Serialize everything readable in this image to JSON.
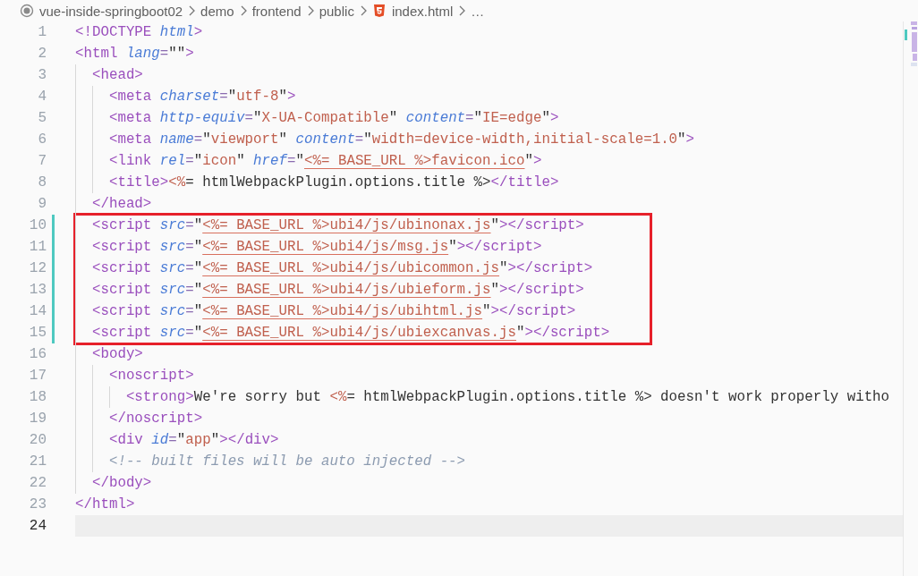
{
  "breadcrumb": {
    "items": [
      {
        "label": "vue-inside-springboot02",
        "kind": "root"
      },
      {
        "label": "demo",
        "kind": "folder"
      },
      {
        "label": "frontend",
        "kind": "folder"
      },
      {
        "label": "public",
        "kind": "folder"
      },
      {
        "label": "index.html",
        "kind": "html-file"
      }
    ],
    "more": "…"
  },
  "editor": {
    "lines": [
      {
        "number": "1",
        "modified": false,
        "boxed": false,
        "current": false,
        "tokens": [
          {
            "kind": "tag",
            "text": "<!DOCTYPE "
          },
          {
            "kind": "attr",
            "text": "html"
          },
          {
            "kind": "tag",
            "text": ">"
          }
        ]
      },
      {
        "number": "2",
        "modified": false,
        "boxed": false,
        "current": false,
        "tokens": [
          {
            "kind": "tag",
            "text": "<html "
          },
          {
            "kind": "attr",
            "text": "lang"
          },
          {
            "kind": "punct",
            "text": "="
          },
          {
            "kind": "text",
            "text": "\"\""
          },
          {
            "kind": "tag",
            "text": ">"
          }
        ]
      },
      {
        "number": "3",
        "modified": false,
        "boxed": false,
        "current": false,
        "tokens": [
          {
            "kind": "tag",
            "text": "  <head>"
          }
        ]
      },
      {
        "number": "4",
        "modified": false,
        "boxed": false,
        "current": false,
        "tokens": [
          {
            "kind": "tag",
            "text": "    <meta "
          },
          {
            "kind": "attr",
            "text": "charset"
          },
          {
            "kind": "punct",
            "text": "="
          },
          {
            "kind": "text",
            "text": "\""
          },
          {
            "kind": "string",
            "text": "utf-8"
          },
          {
            "kind": "text",
            "text": "\""
          },
          {
            "kind": "tag",
            "text": ">"
          }
        ]
      },
      {
        "number": "5",
        "modified": false,
        "boxed": false,
        "current": false,
        "tokens": [
          {
            "kind": "tag",
            "text": "    <meta "
          },
          {
            "kind": "attr",
            "text": "http-equiv"
          },
          {
            "kind": "punct",
            "text": "="
          },
          {
            "kind": "text",
            "text": "\""
          },
          {
            "kind": "string",
            "text": "X-UA-Compatible"
          },
          {
            "kind": "text",
            "text": "\" "
          },
          {
            "kind": "attr",
            "text": "content"
          },
          {
            "kind": "punct",
            "text": "="
          },
          {
            "kind": "text",
            "text": "\""
          },
          {
            "kind": "string",
            "text": "IE=edge"
          },
          {
            "kind": "text",
            "text": "\""
          },
          {
            "kind": "tag",
            "text": ">"
          }
        ]
      },
      {
        "number": "6",
        "modified": false,
        "boxed": false,
        "current": false,
        "tokens": [
          {
            "kind": "tag",
            "text": "    <meta "
          },
          {
            "kind": "attr",
            "text": "name"
          },
          {
            "kind": "punct",
            "text": "="
          },
          {
            "kind": "text",
            "text": "\""
          },
          {
            "kind": "string",
            "text": "viewport"
          },
          {
            "kind": "text",
            "text": "\" "
          },
          {
            "kind": "attr",
            "text": "content"
          },
          {
            "kind": "punct",
            "text": "="
          },
          {
            "kind": "text",
            "text": "\""
          },
          {
            "kind": "string",
            "text": "width=device-width,initial-scale=1.0"
          },
          {
            "kind": "text",
            "text": "\""
          },
          {
            "kind": "tag",
            "text": ">"
          }
        ]
      },
      {
        "number": "7",
        "modified": false,
        "boxed": false,
        "current": false,
        "tokens": [
          {
            "kind": "tag",
            "text": "    <link "
          },
          {
            "kind": "attr",
            "text": "rel"
          },
          {
            "kind": "punct",
            "text": "="
          },
          {
            "kind": "text",
            "text": "\""
          },
          {
            "kind": "string",
            "text": "icon"
          },
          {
            "kind": "text",
            "text": "\" "
          },
          {
            "kind": "attr",
            "text": "href"
          },
          {
            "kind": "punct",
            "text": "="
          },
          {
            "kind": "text",
            "text": "\""
          },
          {
            "kind": "url",
            "text": "<%= BASE_URL %>favicon.ico"
          },
          {
            "kind": "text",
            "text": "\""
          },
          {
            "kind": "tag",
            "text": ">"
          }
        ]
      },
      {
        "number": "8",
        "modified": false,
        "boxed": false,
        "current": false,
        "tokens": [
          {
            "kind": "tag",
            "text": "    <title>"
          },
          {
            "kind": "string",
            "text": "<%"
          },
          {
            "kind": "text",
            "text": "= htmlWebpackPlugin.options.title %>"
          },
          {
            "kind": "tag",
            "text": "</title>"
          }
        ]
      },
      {
        "number": "9",
        "modified": false,
        "boxed": false,
        "current": false,
        "tokens": [
          {
            "kind": "tag",
            "text": "  </head>"
          }
        ]
      },
      {
        "number": "10",
        "modified": true,
        "boxed": true,
        "current": false,
        "tokens": [
          {
            "kind": "tag",
            "text": "  <script "
          },
          {
            "kind": "attr",
            "text": "src"
          },
          {
            "kind": "punct",
            "text": "="
          },
          {
            "kind": "text",
            "text": "\""
          },
          {
            "kind": "url",
            "text": "<%= BASE_URL %>ubi4/js/ubinonax.js"
          },
          {
            "kind": "text",
            "text": "\""
          },
          {
            "kind": "tag",
            "text": "></script>"
          }
        ]
      },
      {
        "number": "11",
        "modified": true,
        "boxed": true,
        "current": false,
        "tokens": [
          {
            "kind": "tag",
            "text": "  <script "
          },
          {
            "kind": "attr",
            "text": "src"
          },
          {
            "kind": "punct",
            "text": "="
          },
          {
            "kind": "text",
            "text": "\""
          },
          {
            "kind": "url",
            "text": "<%= BASE_URL %>ubi4/js/msg.js"
          },
          {
            "kind": "text",
            "text": "\""
          },
          {
            "kind": "tag",
            "text": "></script>"
          }
        ]
      },
      {
        "number": "12",
        "modified": true,
        "boxed": true,
        "current": false,
        "tokens": [
          {
            "kind": "tag",
            "text": "  <script "
          },
          {
            "kind": "attr",
            "text": "src"
          },
          {
            "kind": "punct",
            "text": "="
          },
          {
            "kind": "text",
            "text": "\""
          },
          {
            "kind": "url",
            "text": "<%= BASE_URL %>ubi4/js/ubicommon.js"
          },
          {
            "kind": "text",
            "text": "\""
          },
          {
            "kind": "tag",
            "text": "></script>"
          }
        ]
      },
      {
        "number": "13",
        "modified": true,
        "boxed": true,
        "current": false,
        "tokens": [
          {
            "kind": "tag",
            "text": "  <script "
          },
          {
            "kind": "attr",
            "text": "src"
          },
          {
            "kind": "punct",
            "text": "="
          },
          {
            "kind": "text",
            "text": "\""
          },
          {
            "kind": "url",
            "text": "<%= BASE_URL %>ubi4/js/ubieform.js"
          },
          {
            "kind": "text",
            "text": "\""
          },
          {
            "kind": "tag",
            "text": "></script>"
          }
        ]
      },
      {
        "number": "14",
        "modified": true,
        "boxed": true,
        "current": false,
        "tokens": [
          {
            "kind": "tag",
            "text": "  <script "
          },
          {
            "kind": "attr",
            "text": "src"
          },
          {
            "kind": "punct",
            "text": "="
          },
          {
            "kind": "text",
            "text": "\""
          },
          {
            "kind": "url",
            "text": "<%= BASE_URL %>ubi4/js/ubihtml.js"
          },
          {
            "kind": "text",
            "text": "\""
          },
          {
            "kind": "tag",
            "text": "></script>"
          }
        ]
      },
      {
        "number": "15",
        "modified": true,
        "boxed": true,
        "current": false,
        "tokens": [
          {
            "kind": "tag",
            "text": "  <script "
          },
          {
            "kind": "attr",
            "text": "src"
          },
          {
            "kind": "punct",
            "text": "="
          },
          {
            "kind": "text",
            "text": "\""
          },
          {
            "kind": "url",
            "text": "<%= BASE_URL %>ubi4/js/ubiexcanvas.js"
          },
          {
            "kind": "text",
            "text": "\""
          },
          {
            "kind": "tag",
            "text": "></script>"
          }
        ]
      },
      {
        "number": "16",
        "modified": false,
        "boxed": false,
        "current": false,
        "tokens": [
          {
            "kind": "tag",
            "text": "  <body>"
          }
        ]
      },
      {
        "number": "17",
        "modified": false,
        "boxed": false,
        "current": false,
        "tokens": [
          {
            "kind": "tag",
            "text": "    <noscript>"
          }
        ]
      },
      {
        "number": "18",
        "modified": false,
        "boxed": false,
        "current": false,
        "tokens": [
          {
            "kind": "tag",
            "text": "      <strong>"
          },
          {
            "kind": "text",
            "text": "We're sorry but "
          },
          {
            "kind": "string",
            "text": "<%"
          },
          {
            "kind": "text",
            "text": "= htmlWebpackPlugin.options.title %> doesn't work properly witho"
          }
        ]
      },
      {
        "number": "19",
        "modified": false,
        "boxed": false,
        "current": false,
        "tokens": [
          {
            "kind": "tag",
            "text": "    </noscript>"
          }
        ]
      },
      {
        "number": "20",
        "modified": false,
        "boxed": false,
        "current": false,
        "tokens": [
          {
            "kind": "tag",
            "text": "    <div "
          },
          {
            "kind": "attr",
            "text": "id"
          },
          {
            "kind": "punct",
            "text": "="
          },
          {
            "kind": "text",
            "text": "\""
          },
          {
            "kind": "string",
            "text": "app"
          },
          {
            "kind": "text",
            "text": "\""
          },
          {
            "kind": "tag",
            "text": "></div>"
          }
        ]
      },
      {
        "number": "21",
        "modified": false,
        "boxed": false,
        "current": false,
        "tokens": [
          {
            "kind": "comment",
            "text": "    <!-- built files will be auto injected -->"
          }
        ]
      },
      {
        "number": "22",
        "modified": false,
        "boxed": false,
        "current": false,
        "tokens": [
          {
            "kind": "tag",
            "text": "  </body>"
          }
        ]
      },
      {
        "number": "23",
        "modified": false,
        "boxed": false,
        "current": false,
        "tokens": [
          {
            "kind": "tag",
            "text": "</html>"
          }
        ]
      },
      {
        "number": "24",
        "modified": false,
        "boxed": false,
        "current": true
      }
    ]
  }
}
